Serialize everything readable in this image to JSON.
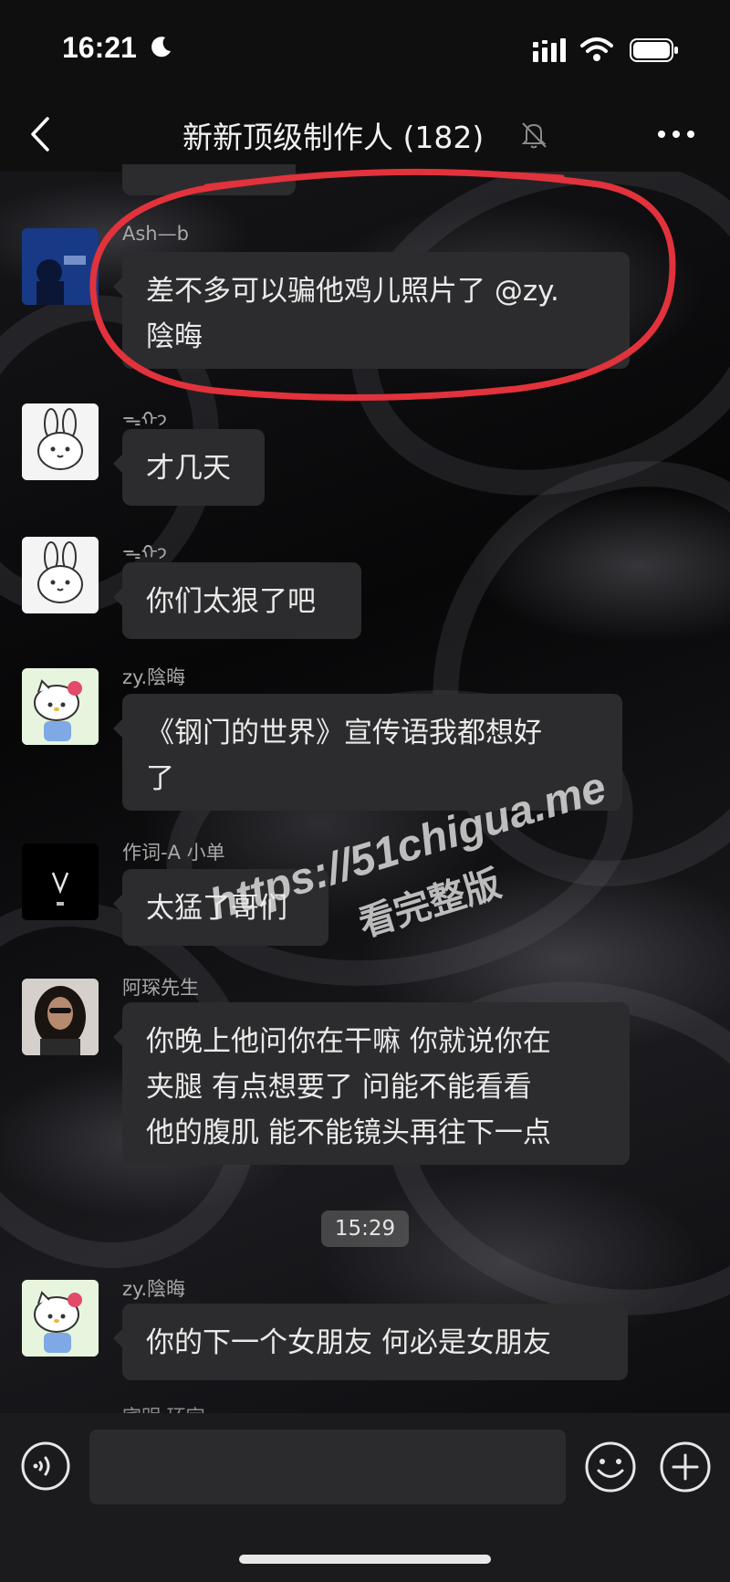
{
  "status_bar": {
    "time": "16:21",
    "icons": [
      "moon-icon",
      "signal-icon",
      "wifi-icon",
      "battery-icon"
    ]
  },
  "nav": {
    "title": "新新顶级制作人 (182)",
    "back_icon": "chevron-left-icon",
    "mute_icon": "bell-off-icon",
    "more_icon": "more-icon"
  },
  "messages": [
    {
      "sender": "Ash—b",
      "text": [
        "差不多可以骗他鸡儿照片了 @zy.",
        "陰晦"
      ],
      "avatar": "blue-photo-avatar"
    },
    {
      "sender": "ᯓᡣ𐭩",
      "text": [
        "才几天"
      ],
      "avatar": "bunny-avatar"
    },
    {
      "sender": "ᯓᡣ𐭩",
      "text": [
        "你们太狠了吧"
      ],
      "avatar": "bunny-avatar"
    },
    {
      "sender": "zy.陰晦",
      "text": [
        "《钢门的世界》宣传语我都想好",
        "了"
      ],
      "avatar": "kitty-avatar"
    },
    {
      "sender": "作词-A 小单",
      "text": [
        "太猛了哥们"
      ],
      "avatar": "letter-v-avatar"
    },
    {
      "sender": "阿琛先生",
      "text": [
        "你晚上他问你在干嘛 你就说你在",
        "夹腿 有点想要了 问能不能看看",
        "他的腹肌 能不能镜头再往下一点"
      ],
      "avatar": "portrait-avatar"
    },
    {
      "sender": "zy.陰晦",
      "text": [
        "你的下一个女朋友 何必是女朋友"
      ],
      "avatar": "kitty-avatar"
    }
  ],
  "timestamp": "15:29",
  "partial_sender": "宾明 环宇",
  "watermark": {
    "url": "https://51chigua.me",
    "subtitle": "看完整版"
  },
  "input_bar": {
    "voice_icon": "voice-icon",
    "emoji_icon": "emoji-icon",
    "plus_icon": "plus-icon",
    "value": ""
  },
  "colors": {
    "bubble": "#2c2c2e",
    "highlight": "#e2323c",
    "background": "#0c0c0e"
  }
}
